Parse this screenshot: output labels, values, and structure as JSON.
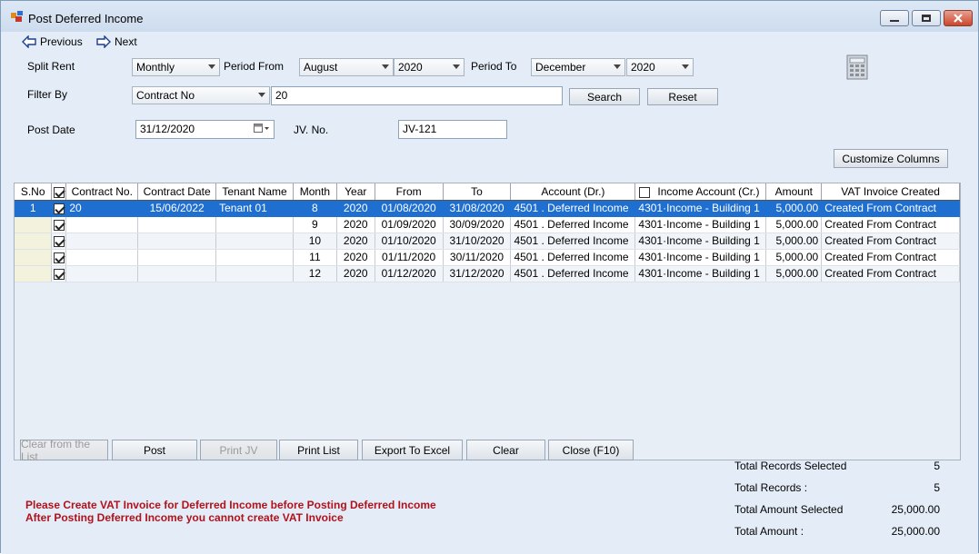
{
  "window": {
    "title": "Post Deferred Income"
  },
  "nav": {
    "previous": "Previous",
    "next": "Next"
  },
  "filters": {
    "split_rent_label": "Split Rent",
    "split_rent_value": "Monthly",
    "period_from_label": "Period From",
    "period_from_month": "August",
    "period_from_year": "2020",
    "period_to_label": "Period To",
    "period_to_month": "December",
    "period_to_year": "2020",
    "filter_by_label": "Filter By",
    "filter_by_value": "Contract No",
    "filter_text": "20",
    "search": "Search",
    "reset": "Reset",
    "post_date_label": "Post Date",
    "post_date_value": "31/12/2020",
    "jv_no_label": "JV. No.",
    "jv_no_value": "JV-121",
    "customize_columns": "Customize Columns"
  },
  "table": {
    "columns": [
      "S.No",
      "",
      "Contract No.",
      "Contract Date",
      "Tenant Name",
      "Month",
      "Year",
      "From",
      "To",
      "Account  (Dr.)",
      "Income Account (Cr.)",
      "Amount",
      "VAT Invoice Created"
    ],
    "rows": [
      {
        "sno": "1",
        "checked": true,
        "contract_no": "20",
        "contract_date": "15/06/2022",
        "tenant": "Tenant 01",
        "month": "8",
        "year": "2020",
        "from": "01/08/2020",
        "to": "31/08/2020",
        "account_dr": "4501 . Deferred Income",
        "income_account": "4301·Income - Building 1",
        "amount": "5,000.00",
        "vat": "Created From Contract",
        "selected": true
      },
      {
        "sno": "",
        "checked": true,
        "contract_no": "",
        "contract_date": "",
        "tenant": "",
        "month": "9",
        "year": "2020",
        "from": "01/09/2020",
        "to": "30/09/2020",
        "account_dr": "4501 . Deferred Income",
        "income_account": "4301·Income - Building 1",
        "amount": "5,000.00",
        "vat": "Created From Contract",
        "selected": false
      },
      {
        "sno": "",
        "checked": true,
        "contract_no": "",
        "contract_date": "",
        "tenant": "",
        "month": "10",
        "year": "2020",
        "from": "01/10/2020",
        "to": "31/10/2020",
        "account_dr": "4501 . Deferred Income",
        "income_account": "4301·Income - Building 1",
        "amount": "5,000.00",
        "vat": "Created From Contract",
        "selected": false
      },
      {
        "sno": "",
        "checked": true,
        "contract_no": "",
        "contract_date": "",
        "tenant": "",
        "month": "11",
        "year": "2020",
        "from": "01/11/2020",
        "to": "30/11/2020",
        "account_dr": "4501 . Deferred Income",
        "income_account": "4301·Income - Building 1",
        "amount": "5,000.00",
        "vat": "Created From Contract",
        "selected": false
      },
      {
        "sno": "",
        "checked": true,
        "contract_no": "",
        "contract_date": "",
        "tenant": "",
        "month": "12",
        "year": "2020",
        "from": "01/12/2020",
        "to": "31/12/2020",
        "account_dr": "4501 . Deferred Income",
        "income_account": "4301·Income - Building 1",
        "amount": "5,000.00",
        "vat": "Created From Contract",
        "selected": false
      }
    ]
  },
  "actions": {
    "clear_from_list": "Clear from the List",
    "post": "Post",
    "print_jv": "Print JV",
    "print_list": "Print List",
    "export_excel": "Export To Excel",
    "clear": "Clear",
    "close": "Close (F10)"
  },
  "messages": {
    "line1": "Please Create VAT Invoice for Deferred Income before Posting Deferred Income",
    "line2": "After Posting Deferred Income you cannot create VAT Invoice"
  },
  "totals": {
    "records_selected_label": "Total Records  Selected",
    "records_selected_value": "5",
    "records_label": "Total Records :",
    "records_value": "5",
    "amount_selected_label": "Total Amount Selected",
    "amount_selected_value": "25,000.00",
    "amount_label": "Total Amount :",
    "amount_value": "25,000.00"
  },
  "colors": {
    "selection": "#1f6fd1",
    "message": "#b0121b"
  }
}
